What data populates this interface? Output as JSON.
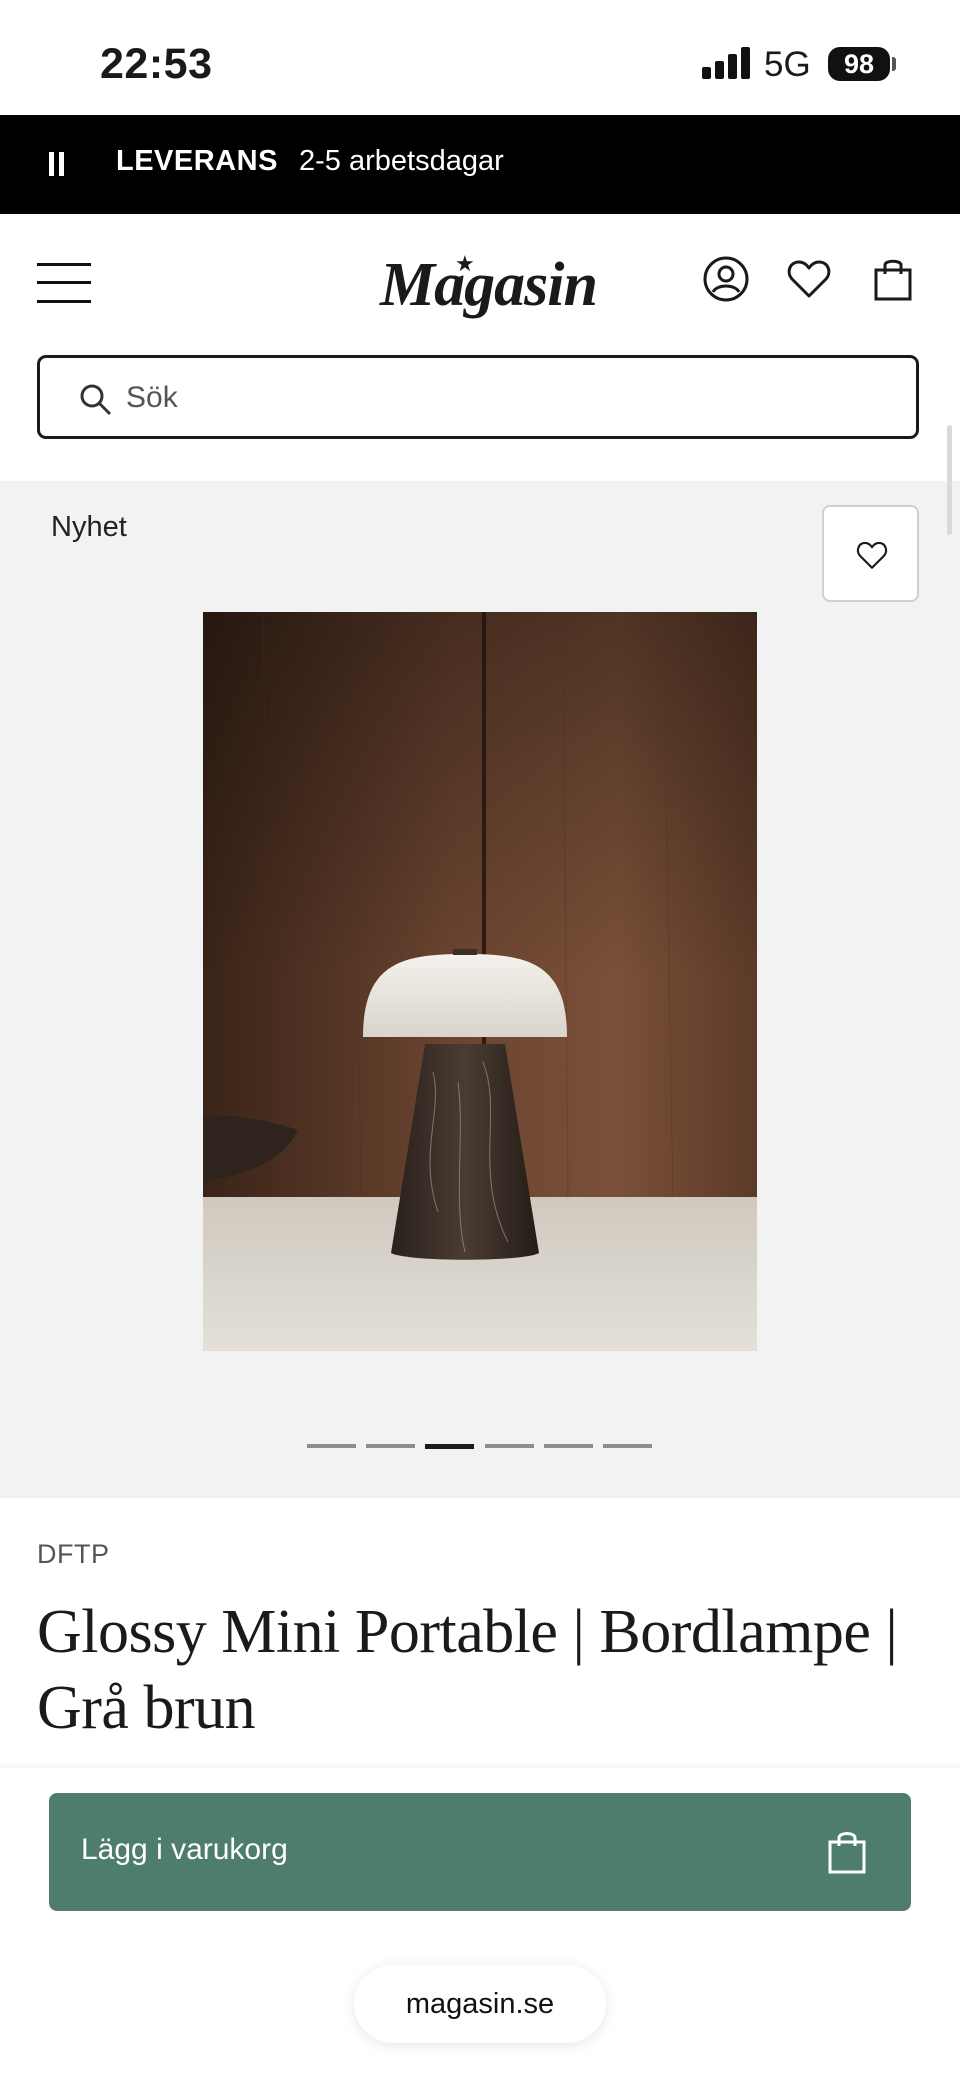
{
  "status_bar": {
    "time": "22:53",
    "network": "5G",
    "battery": "98"
  },
  "banner": {
    "label": "LEVERANS",
    "value": "2-5 arbetsdagar"
  },
  "header": {
    "logo": "Magasin"
  },
  "search": {
    "placeholder": "Sök"
  },
  "gallery": {
    "badge": "Nyhet",
    "dots_count": 6,
    "active_dot": 3
  },
  "product": {
    "brand": "DFTP",
    "title": "Glossy Mini Portable | Bordlampe | Grå brun"
  },
  "cart": {
    "label": "Lägg i varukorg"
  },
  "browser": {
    "url": "magasin.se"
  },
  "colors": {
    "accent": "#4e7d6d",
    "banner_bg": "#000000",
    "gallery_bg": "#f2f2f2"
  }
}
